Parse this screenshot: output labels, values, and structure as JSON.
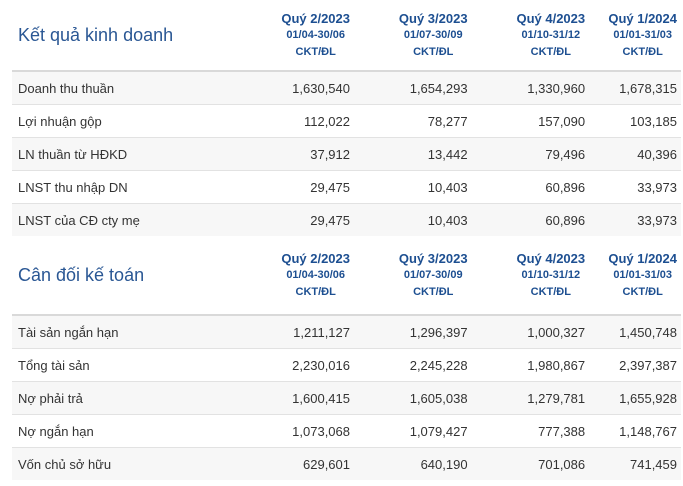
{
  "sections": [
    {
      "title": "Kết quả kinh doanh",
      "quarters": [
        {
          "name": "Quý 2/2023",
          "range": "01/04-30/06",
          "unit": "CKT/ĐL"
        },
        {
          "name": "Quý 3/2023",
          "range": "01/07-30/09",
          "unit": "CKT/ĐL"
        },
        {
          "name": "Quý 4/2023",
          "range": "01/10-31/12",
          "unit": "CKT/ĐL"
        },
        {
          "name": "Quý 1/2024",
          "range": "01/01-31/03",
          "unit": "CKT/ĐL"
        }
      ],
      "rows": [
        {
          "label": "Doanh thu thuần",
          "values": [
            "1,630,540",
            "1,654,293",
            "1,330,960",
            "1,678,315"
          ]
        },
        {
          "label": "Lợi nhuận gộp",
          "values": [
            "112,022",
            "78,277",
            "157,090",
            "103,185"
          ]
        },
        {
          "label": "LN thuần từ HĐKD",
          "values": [
            "37,912",
            "13,442",
            "79,496",
            "40,396"
          ]
        },
        {
          "label": "LNST thu nhập DN",
          "values": [
            "29,475",
            "10,403",
            "60,896",
            "33,973"
          ]
        },
        {
          "label": "LNST của CĐ cty mẹ",
          "values": [
            "29,475",
            "10,403",
            "60,896",
            "33,973"
          ]
        }
      ]
    },
    {
      "title": "Cân đối kế toán",
      "quarters": [
        {
          "name": "Quý 2/2023",
          "range": "01/04-30/06",
          "unit": "CKT/ĐL"
        },
        {
          "name": "Quý 3/2023",
          "range": "01/07-30/09",
          "unit": "CKT/ĐL"
        },
        {
          "name": "Quý 4/2023",
          "range": "01/10-31/12",
          "unit": "CKT/ĐL"
        },
        {
          "name": "Quý 1/2024",
          "range": "01/01-31/03",
          "unit": "CKT/ĐL"
        }
      ],
      "rows": [
        {
          "label": "Tài sản ngắn hạn",
          "values": [
            "1,211,127",
            "1,296,397",
            "1,000,327",
            "1,450,748"
          ]
        },
        {
          "label": "Tổng tài sản",
          "values": [
            "2,230,016",
            "2,245,228",
            "1,980,867",
            "2,397,387"
          ]
        },
        {
          "label": "Nợ phải trả",
          "values": [
            "1,600,415",
            "1,605,038",
            "1,279,781",
            "1,655,928"
          ]
        },
        {
          "label": "Nợ ngắn hạn",
          "values": [
            "1,073,068",
            "1,079,427",
            "777,388",
            "1,148,767"
          ]
        },
        {
          "label": "Vốn chủ sở hữu",
          "values": [
            "629,601",
            "640,190",
            "701,086",
            "741,459"
          ]
        }
      ]
    }
  ],
  "colors": {
    "title": "#2a5794",
    "quarter_header": "#1d4f91",
    "row_stripe": "#f7f7f7",
    "border": "#e2e2e2"
  }
}
